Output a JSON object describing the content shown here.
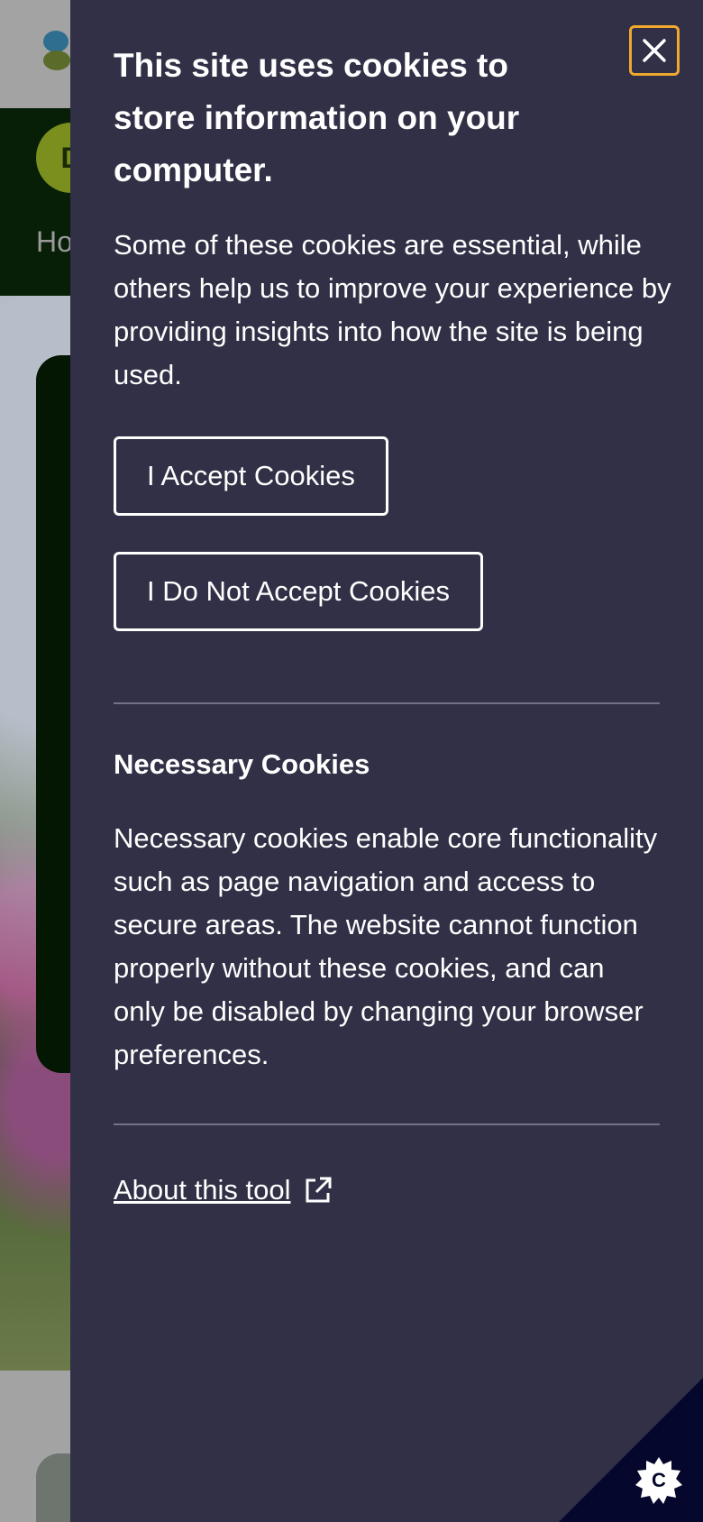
{
  "background": {
    "avatar_letter": "D",
    "nav_link": "Ho"
  },
  "cookie_panel": {
    "title": "This site uses cookies to store information on your computer.",
    "intro": "Some of these cookies are essential, while others help us to improve your experience by providing insights into how the site is being used.",
    "accept_label": "I Accept Cookies",
    "reject_label": "I Do Not Accept Cookies",
    "necessary_title": "Necessary Cookies",
    "necessary_body": "Necessary cookies enable core functionality such as page navigation and access to secure areas. The website cannot function properly without these cookies, and can only be disabled by changing your browser preferences.",
    "about_link": "About this tool",
    "close_icon": "close-icon",
    "external_icon": "external-link-icon",
    "corner_icon": "cookie-settings-icon"
  },
  "colors": {
    "panel_bg": "#313046",
    "close_focus": "#f0a92e",
    "corner_bg": "#05072c",
    "nav_bg": "#061f06"
  }
}
